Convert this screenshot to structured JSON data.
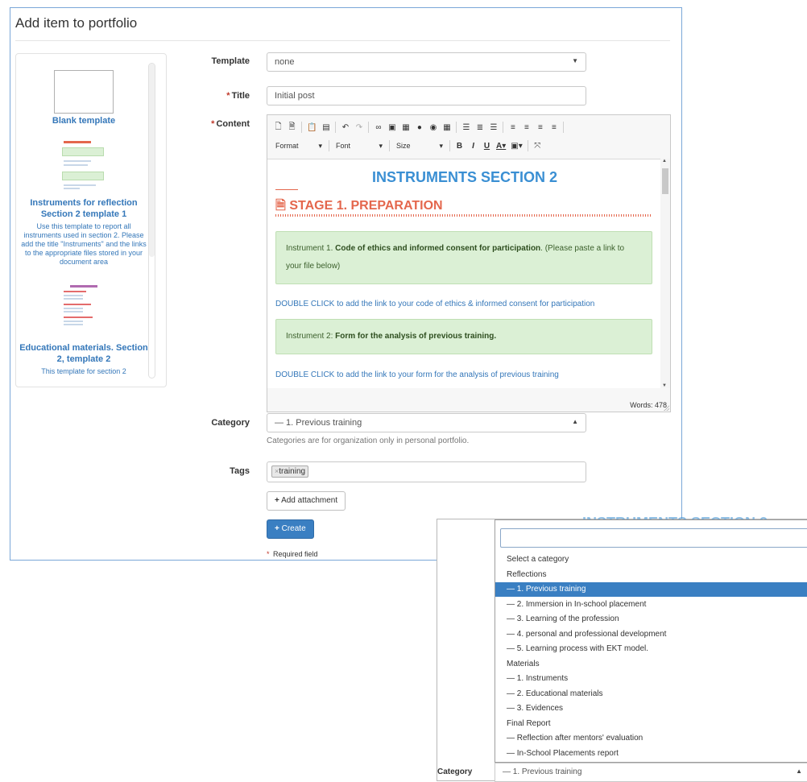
{
  "card": {
    "title": "Add item to portfolio"
  },
  "templates": [
    {
      "name": "Blank template",
      "desc": ""
    },
    {
      "name": "Instruments for reflection Section 2 template 1",
      "desc": "Use this template to report all instruments used in section 2. Please add the title \"Instruments\" and the links to the appropriate files stored in your document area"
    },
    {
      "name": "Educational materials. Section 2, template 2",
      "desc": "This template for section 2"
    }
  ],
  "form": {
    "template_label": "Template",
    "template_value": "none",
    "title_label": "Title",
    "title_value": "Initial post",
    "content_label": "Content",
    "required_mark": "*",
    "category_label": "Category",
    "category_value": "— 1. Previous training",
    "category_hint": "Categories are for organization only in personal portfolio.",
    "tags_label": "Tags",
    "tag_chip": "training",
    "tag_remove": "×",
    "add_attachment": "Add attachment",
    "create": "Create",
    "required_note": "Required field"
  },
  "editor": {
    "format_label": "Format",
    "font_label": "Font",
    "size_label": "Size",
    "bold": "B",
    "italic": "I",
    "underline": "U",
    "heading": "INSTRUMENTS SECTION 2",
    "stage": "STAGE 1. PREPARATION",
    "box1_prefix": "Instrument 1. ",
    "box1_bold": "Code of ethics and informed consent for participation",
    "box1_suffix": ". (Please paste a link to your file below)",
    "link1": "DOUBLE CLICK to add the link to your code of ethics & informed consent for participation",
    "box2_prefix": "Instrument 2: ",
    "box2_bold": "Form for the analysis of previous training.",
    "link2": "DOUBLE CLICK to add the link to your form for the analysis of previous training",
    "words": "Words: 478"
  },
  "dropdown": {
    "ghost_heading": "INSTRUMENTS SECTION 2",
    "search_value": "",
    "options": [
      {
        "label": "Select a category",
        "selected": false
      },
      {
        "label": "Reflections",
        "selected": false
      },
      {
        "label": "— 1. Previous training",
        "selected": true
      },
      {
        "label": "— 2. Immersion in In-school placement",
        "selected": false
      },
      {
        "label": "— 3. Learning of the profession",
        "selected": false
      },
      {
        "label": "— 4. personal and professional development",
        "selected": false
      },
      {
        "label": "— 5. Learning process with EKT model.",
        "selected": false
      },
      {
        "label": "Materials",
        "selected": false
      },
      {
        "label": "— 1. Instruments",
        "selected": false
      },
      {
        "label": "— 2. Educational materials",
        "selected": false
      },
      {
        "label": "— 3. Evidences",
        "selected": false
      },
      {
        "label": "Final Report",
        "selected": false
      },
      {
        "label": "— Reflection after mentors' evaluation",
        "selected": false
      },
      {
        "label": "— In-School Placements report",
        "selected": false
      }
    ],
    "category_label": "Category",
    "category_value": "— 1. Previous training"
  },
  "colors": {
    "accent": "#3a7fc2",
    "heading": "#3a8fd3",
    "stage": "#e4674d",
    "green_box": "#dbf0d5"
  }
}
